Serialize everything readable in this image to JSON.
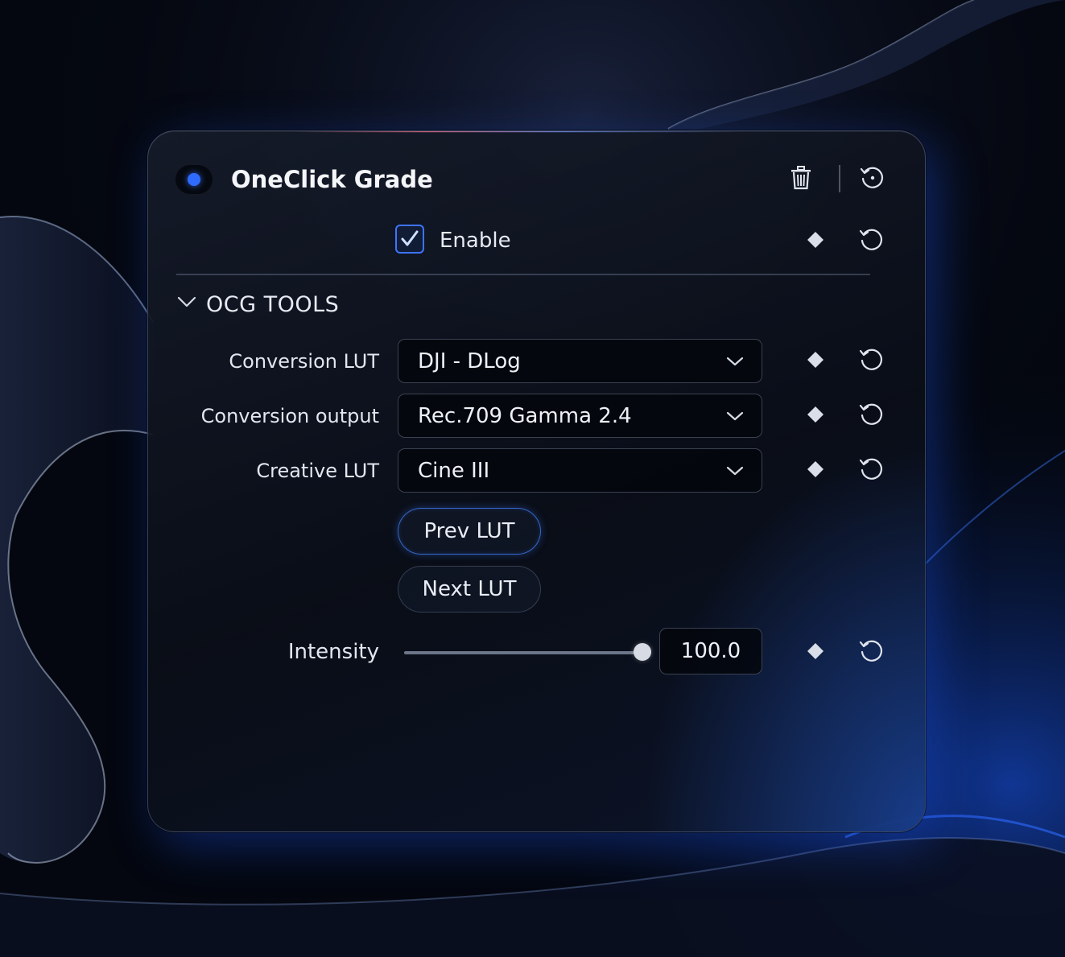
{
  "colors": {
    "accent": "#3d74ff",
    "status_dot": "#2f6bff",
    "panel_bg": "#0e1320",
    "text": "#e9edf5"
  },
  "header": {
    "title": "OneClick Grade",
    "status_dot_icon": "status-dot",
    "delete_icon": "trash-icon",
    "reset_all_icon": "reset-icon"
  },
  "enable": {
    "label": "Enable",
    "checked": true
  },
  "section": {
    "title": "OCG TOOLS",
    "expanded": true
  },
  "rows": {
    "conversion_lut": {
      "label": "Conversion LUT",
      "value": "DJI - DLog"
    },
    "conversion_output": {
      "label": "Conversion output",
      "value": "Rec.709 Gamma 2.4"
    },
    "creative_lut": {
      "label": "Creative LUT",
      "value": "Cine III"
    }
  },
  "buttons": {
    "prev": "Prev LUT",
    "next": "Next LUT"
  },
  "intensity": {
    "label": "Intensity",
    "value": "100.0",
    "level": 1.0
  },
  "icons": {
    "keyframe": "keyframe-diamond-icon",
    "reset": "reset-icon",
    "dropdown": "chevron-down-icon"
  }
}
